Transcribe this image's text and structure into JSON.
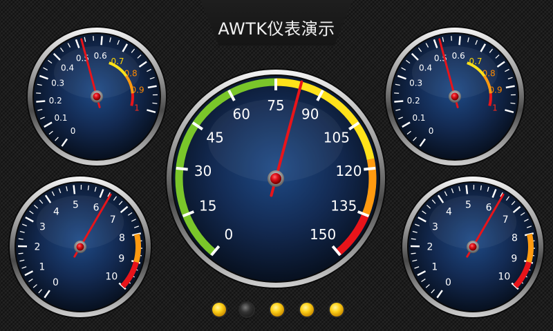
{
  "title": "AWTK仪表演示",
  "colors": {
    "needle": "#e8141a",
    "tick": "#ffffff",
    "label_white": "#ffffff",
    "label_yellow": "#ffd400",
    "label_orange": "#ff8a00",
    "label_red": "#ff2a1a",
    "arc_green": "#7ac62a",
    "arc_yellow": "#ffe21a",
    "arc_orange": "#ff9a10",
    "arc_red": "#e8141a",
    "dial_center": "#1e4a86",
    "dial_edge": "#07101f"
  },
  "gauges": [
    {
      "name": "gauge-top-left",
      "type": "small",
      "labels": [
        "0",
        "0.1",
        "0.2",
        "0.3",
        "0.4",
        "0.5",
        "0.6",
        "0.7",
        "0.8",
        "0.9",
        "1"
      ],
      "label_colors": [
        "w",
        "w",
        "w",
        "w",
        "w",
        "w",
        "w",
        "y",
        "o",
        "o",
        "r"
      ],
      "value": 0.52,
      "scale_min": 0,
      "scale_max": 1
    },
    {
      "name": "gauge-top-right",
      "type": "small",
      "labels": [
        "0",
        "0.1",
        "0.2",
        "0.3",
        "0.4",
        "0.5",
        "0.6",
        "0.7",
        "0.8",
        "0.9",
        "1"
      ],
      "label_colors": [
        "w",
        "w",
        "w",
        "w",
        "w",
        "w",
        "w",
        "y",
        "o",
        "o",
        "r"
      ],
      "value": 0.52,
      "scale_min": 0,
      "scale_max": 1
    },
    {
      "name": "gauge-center",
      "type": "big",
      "labels": [
        "0",
        "15",
        "30",
        "45",
        "60",
        "75",
        "90",
        "105",
        "120",
        "135",
        "150"
      ],
      "value": 83,
      "scale_min": 0,
      "scale_max": 150
    },
    {
      "name": "gauge-bottom-left",
      "type": "medium",
      "labels": [
        "0",
        "1",
        "2",
        "3",
        "4",
        "5",
        "6",
        "7",
        "8",
        "9",
        "10"
      ],
      "value": 6.3,
      "scale_min": 0,
      "scale_max": 10
    },
    {
      "name": "gauge-bottom-right",
      "type": "medium",
      "labels": [
        "0",
        "1",
        "2",
        "3",
        "4",
        "5",
        "6",
        "7",
        "8",
        "9",
        "10"
      ],
      "value": 6.3,
      "scale_min": 0,
      "scale_max": 10
    }
  ],
  "leds": [
    {
      "name": "led-1",
      "state": "on"
    },
    {
      "name": "led-2",
      "state": "off"
    },
    {
      "name": "led-3",
      "state": "on"
    },
    {
      "name": "led-4",
      "state": "on"
    },
    {
      "name": "led-5",
      "state": "on"
    }
  ]
}
